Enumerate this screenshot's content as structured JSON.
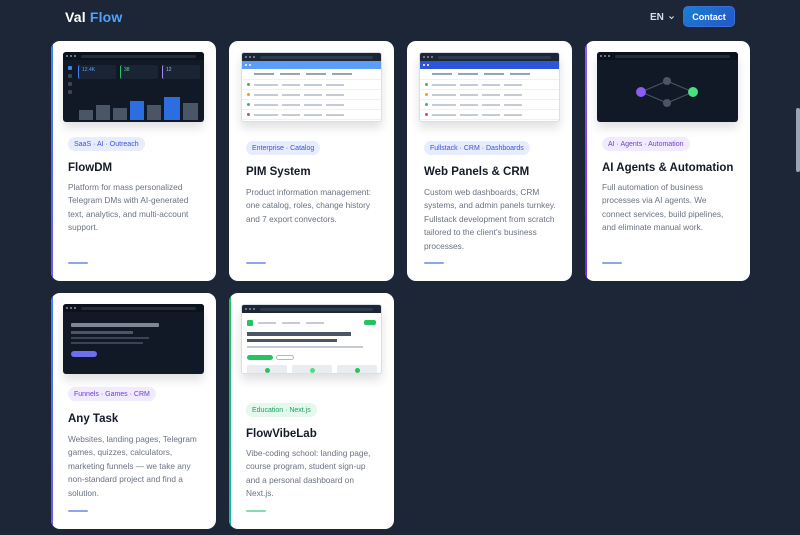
{
  "header": {
    "logo_part1": "Val",
    "logo_part2": "Flow",
    "language": "EN",
    "contact_label": "Contact"
  },
  "cards": [
    {
      "tag": "SaaS · AI · Outreach",
      "title": "FlowDM",
      "description": "Platform for mass personalized Telegram DMs with AI-generated text, analytics, and multi-account support.",
      "preview": {
        "stats": [
          "12.4K",
          "38",
          "12"
        ]
      }
    },
    {
      "tag": "Enterprise · Catalog",
      "title": "PIM System",
      "description": "Product information management: one catalog, roles, change history and 7 export convectors."
    },
    {
      "tag": "Fullstack · CRM · Dashboards",
      "title": "Web Panels & CRM",
      "description": "Custom web dashboards, CRM systems, and admin panels turnkey. Fullstack development from scratch tailored to the client's business processes."
    },
    {
      "tag": "AI · Agents · Automation",
      "title": "AI Agents & Automation",
      "description": "Full automation of business processes via AI agents. We connect services, build pipelines, and eliminate manual work."
    },
    {
      "tag": "Funnels · Games · CRM",
      "title": "Any Task",
      "description": "Websites, landing pages, Telegram games, quizzes, calculators, marketing funnels — we take any non-standard project and find a solution."
    },
    {
      "tag": "Education · Next.js",
      "title": "FlowVibeLab",
      "description": "Vibe-coding school: landing page, course program, student sign-up and a personal dashboard on Next.js."
    }
  ],
  "colors": {
    "background": "#1c2636",
    "accent": "#4fa3ff",
    "contact_button": "#1a7fd1",
    "green": "#22c55e",
    "purple": "#8b5cf6"
  }
}
